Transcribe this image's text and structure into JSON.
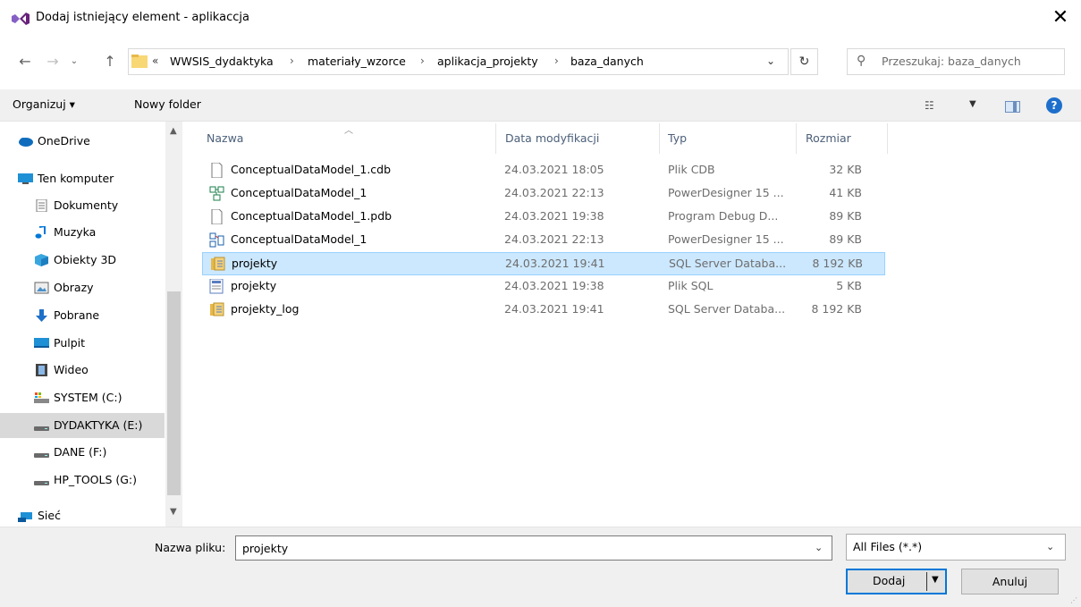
{
  "window": {
    "title": "Dodaj istniejący element - aplikaccja",
    "close_glyph": "✕"
  },
  "address_bar": {
    "overflow_glyph": "«",
    "crumbs": [
      "WWSIS_dydaktyka",
      "materiały_wzorce",
      "aplikacja_projekty",
      "baza_danych"
    ],
    "separator": "›",
    "search_placeholder": "Przeszukaj: baza_danych"
  },
  "toolbar": {
    "organize_label": "Organizuj ▾",
    "new_folder_label": "Nowy folder",
    "help_label": "?"
  },
  "sidebar": {
    "items": [
      {
        "label": "OneDrive",
        "icon": "cloud-icon",
        "selected": false
      },
      {
        "label": "Ten komputer",
        "icon": "computer-icon",
        "selected": false
      },
      {
        "label": "Dokumenty",
        "icon": "documents-icon",
        "selected": false
      },
      {
        "label": "Muzyka",
        "icon": "music-icon",
        "selected": false
      },
      {
        "label": "Obiekty 3D",
        "icon": "cube-icon",
        "selected": false
      },
      {
        "label": "Obrazy",
        "icon": "pictures-icon",
        "selected": false
      },
      {
        "label": "Pobrane",
        "icon": "download-icon",
        "selected": false
      },
      {
        "label": "Pulpit",
        "icon": "desktop-icon",
        "selected": false
      },
      {
        "label": "Wideo",
        "icon": "video-icon",
        "selected": false
      },
      {
        "label": "SYSTEM (C:)",
        "icon": "system-drive-icon",
        "selected": false
      },
      {
        "label": "DYDAKTYKA (E:)",
        "icon": "drive-icon",
        "selected": true
      },
      {
        "label": "DANE (F:)",
        "icon": "drive-icon",
        "selected": false
      },
      {
        "label": "HP_TOOLS (G:)",
        "icon": "drive-icon",
        "selected": false
      },
      {
        "label": "Sieć",
        "icon": "network-icon",
        "selected": false
      }
    ]
  },
  "file_list": {
    "columns": [
      "Nazwa",
      "Data modyfikacji",
      "Typ",
      "Rozmiar"
    ],
    "rows": [
      {
        "name": "ConceptualDataModel_1.cdb",
        "date": "24.03.2021 18:05",
        "type": "Plik CDB",
        "size": "32 KB",
        "icon": "blank-file-icon",
        "selected": false
      },
      {
        "name": "ConceptualDataModel_1",
        "date": "24.03.2021 22:13",
        "type": "PowerDesigner 15 ...",
        "size": "41 KB",
        "icon": "powerdesigner-cdm-icon",
        "selected": false
      },
      {
        "name": "ConceptualDataModel_1.pdb",
        "date": "24.03.2021 19:38",
        "type": "Program Debug D...",
        "size": "89 KB",
        "icon": "blank-file-icon",
        "selected": false
      },
      {
        "name": "ConceptualDataModel_1",
        "date": "24.03.2021 22:13",
        "type": "PowerDesigner 15 ...",
        "size": "89 KB",
        "icon": "powerdesigner-pdm-icon",
        "selected": false
      },
      {
        "name": "projekty",
        "date": "24.03.2021 19:41",
        "type": "SQL Server Databa...",
        "size": "8 192 KB",
        "icon": "sql-database-icon",
        "selected": true
      },
      {
        "name": "projekty",
        "date": "24.03.2021 19:38",
        "type": "Plik SQL",
        "size": "5 KB",
        "icon": "sql-script-icon",
        "selected": false
      },
      {
        "name": "projekty_log",
        "date": "24.03.2021 19:41",
        "type": "SQL Server Databa...",
        "size": "8 192 KB",
        "icon": "sql-database-icon",
        "selected": false
      }
    ]
  },
  "footer": {
    "filename_label": "Nazwa pliku:",
    "filename_value": "projekty",
    "filetype_value": "All Files (*.*)",
    "add_label": "Dodaj",
    "cancel_label": "Anuluj"
  },
  "colors": {
    "accent": "#0078d7",
    "selection_bg": "#cce8ff",
    "selection_border": "#99d1ff",
    "header_text": "#4c607a",
    "visual_studio_purple": "#865fc5"
  }
}
